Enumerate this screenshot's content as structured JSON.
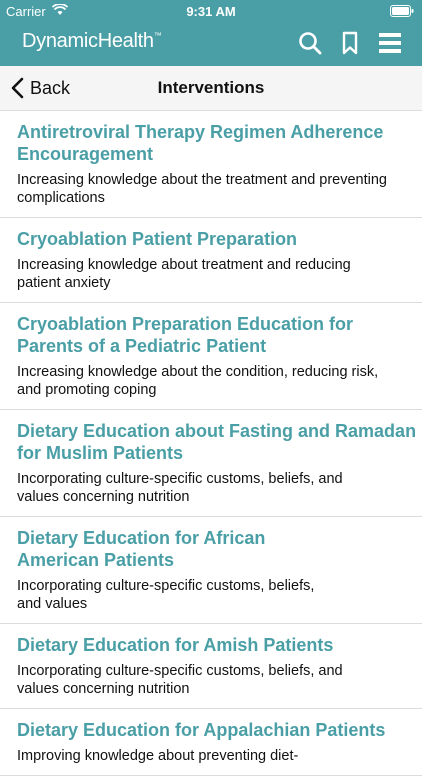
{
  "status": {
    "carrier": "Carrier",
    "time": "9:31 AM"
  },
  "header": {
    "logo": "DynamicHealth",
    "logo_mark": "™"
  },
  "nav": {
    "back_label": "Back",
    "title": "Interventions"
  },
  "items": [
    {
      "title": [
        "Antiretroviral Therapy Regimen Adherence",
        "Encouragement"
      ],
      "desc": [
        "Increasing knowledge about the treatment and preventing",
        "complications"
      ]
    },
    {
      "title": [
        "Cryoablation Patient Preparation"
      ],
      "desc": [
        "Increasing knowledge about treatment and reducing",
        "patient anxiety"
      ]
    },
    {
      "title": [
        "Cryoablation Preparation Education for",
        "Parents of a Pediatric Patient"
      ],
      "desc": [
        "Increasing knowledge about the condition, reducing risk,",
        "and promoting coping"
      ]
    },
    {
      "title": [
        "Dietary Education about Fasting and Ramadan",
        "for Muslim Patients"
      ],
      "desc": [
        "Incorporating culture-specific customs, beliefs, and",
        "values concerning nutrition"
      ]
    },
    {
      "title": [
        "Dietary Education for African",
        "American Patients"
      ],
      "desc": [
        "Incorporating culture-specific customs, beliefs,",
        "and values"
      ]
    },
    {
      "title": [
        "Dietary Education for Amish Patients"
      ],
      "desc": [
        "Incorporating culture-specific customs, beliefs, and",
        "values concerning nutrition"
      ]
    },
    {
      "title": [
        "Dietary Education for Appalachian Patients"
      ],
      "desc": [
        "Improving knowledge about preventing diet-"
      ]
    }
  ]
}
